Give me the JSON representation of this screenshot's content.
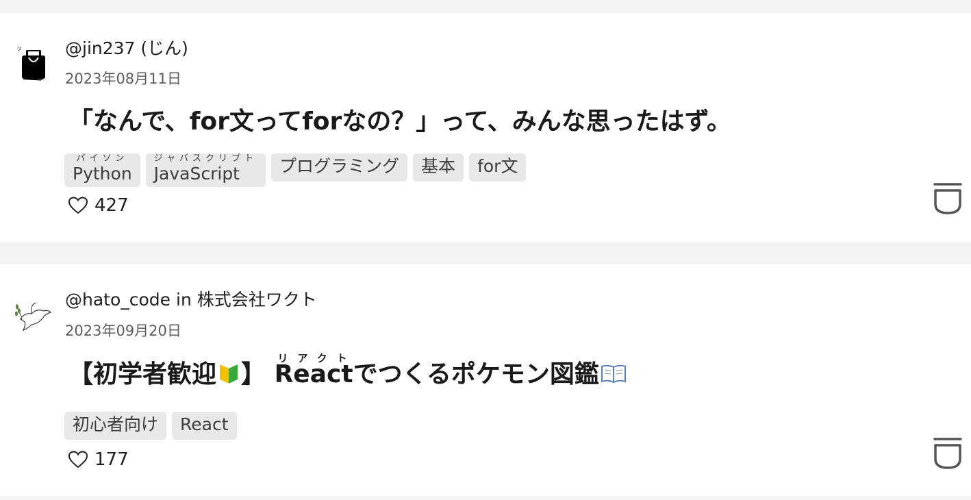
{
  "articles": [
    {
      "author": "@jin237 (じん)",
      "date": "2023年08月11日",
      "title": "「なんで、for文ってforなの？」って、みんな思ったはず。",
      "tags": [
        {
          "label": "Python",
          "ruby": "パイソン"
        },
        {
          "label": "JavaScript",
          "ruby": "ジャバスクリプト"
        },
        {
          "label": "プログラミング"
        },
        {
          "label": "基本"
        },
        {
          "label": "for文"
        }
      ],
      "likes": "427",
      "icons": {
        "avatar": "avatar-icon",
        "like": "heart-icon",
        "stock": "stock-icon"
      }
    },
    {
      "author": "@hato_code in 株式会社ワクト",
      "date": "2023年09月20日",
      "title_prefix": "【初学者歓迎",
      "title_prefix_close": "】",
      "title_ruby_base": "React",
      "title_ruby_text": "リアクト",
      "title_suffix": "でつくるポケモン図鑑",
      "tags": [
        {
          "label": "初心者向け"
        },
        {
          "label": "React"
        }
      ],
      "likes": "177",
      "icons": {
        "avatar": "dove-icon",
        "badge": "beginner-mark-icon",
        "book": "open-book-icon",
        "like": "heart-icon",
        "stock": "stock-icon"
      }
    }
  ]
}
